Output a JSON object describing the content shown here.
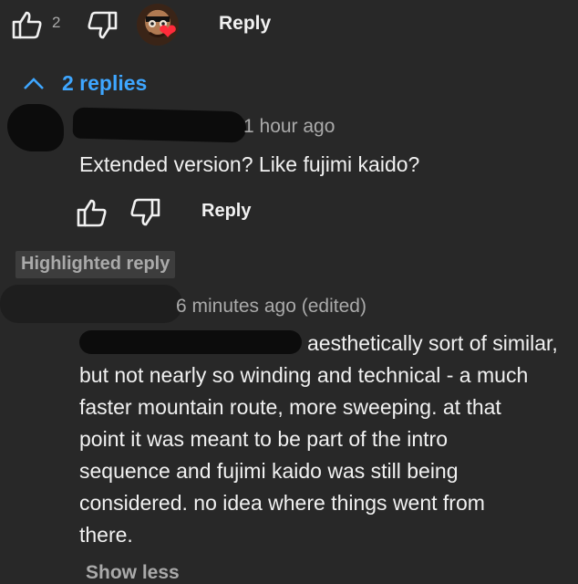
{
  "parent_comment": {
    "like_count": "2",
    "reply_label": "Reply",
    "icons": [
      "thumbs-up-icon",
      "thumbs-down-icon",
      "creator-heart-icon"
    ]
  },
  "replies_toggle": {
    "label": "2 replies",
    "icon": "chevron-up-icon"
  },
  "reply_1": {
    "timestamp": "1 hour ago",
    "text": "Extended version? Like fujimi kaido?",
    "reply_label": "Reply"
  },
  "reply_2": {
    "badge": "Highlighted reply",
    "timestamp": "6 minutes ago (edited)",
    "text_lines": [
      "aesthetically sort of similar,",
      "but not nearly so winding and technical - a much",
      "faster mountain route, more sweeping. at that",
      "point it was meant to be part of the intro",
      "sequence and fujimi kaido was still being",
      "considered. no idea where things went from",
      "there."
    ],
    "show_less_label": "Show less"
  },
  "colors": {
    "background": "#282828",
    "text": "#f1f1f1",
    "secondary_text": "#aaaaaa",
    "link_blue": "#3ea6ff",
    "heart_red": "#ff2b3a"
  }
}
